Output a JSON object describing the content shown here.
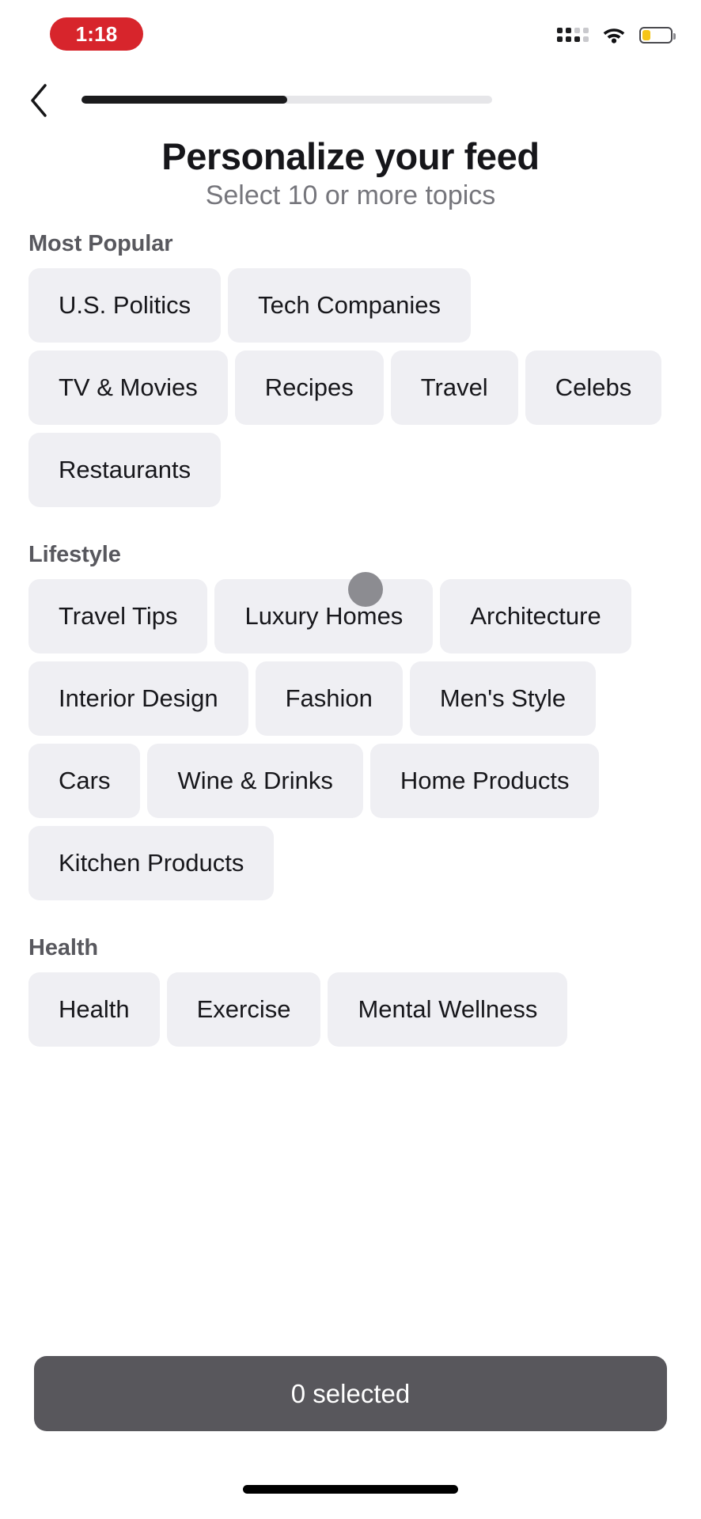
{
  "status_bar": {
    "time": "1:18",
    "time_pill_color": "#D7252C",
    "cellular_icon": "cellular-dots-icon",
    "wifi_icon": "wifi-icon",
    "battery_icon": "battery-low-icon",
    "battery_level_percent": 26,
    "battery_fill_color": "#F5C518"
  },
  "header": {
    "back_icon": "chevron-left-icon",
    "progress_percent": 50,
    "progress_fill_color": "#1b1b1d",
    "progress_track_color": "#E6E6E9"
  },
  "page": {
    "title": "Personalize your feed",
    "subtitle": "Select 10 or more topics"
  },
  "sections": [
    {
      "title": "Most Popular",
      "topics": [
        "U.S. Politics",
        "Tech Companies",
        "TV & Movies",
        "Recipes",
        "Travel",
        "Celebs",
        "Restaurants"
      ]
    },
    {
      "title": "Lifestyle",
      "topics": [
        "Travel Tips",
        "Luxury Homes",
        "Architecture",
        "Interior Design",
        "Fashion",
        "Men's Style",
        "Cars",
        "Wine & Drinks",
        "Home Products",
        "Kitchen Products"
      ]
    },
    {
      "title": "Health",
      "topics": [
        "Health",
        "Exercise",
        "Mental Wellness"
      ]
    }
  ],
  "footer": {
    "cta_label": "0 selected",
    "cta_color": "#58575C",
    "selected_count": 0
  },
  "chip_style": {
    "background": "#EFEFF3",
    "text_color": "#17171b"
  },
  "cursor": {
    "name": "touch-indicator",
    "color": "#8c8c91"
  }
}
